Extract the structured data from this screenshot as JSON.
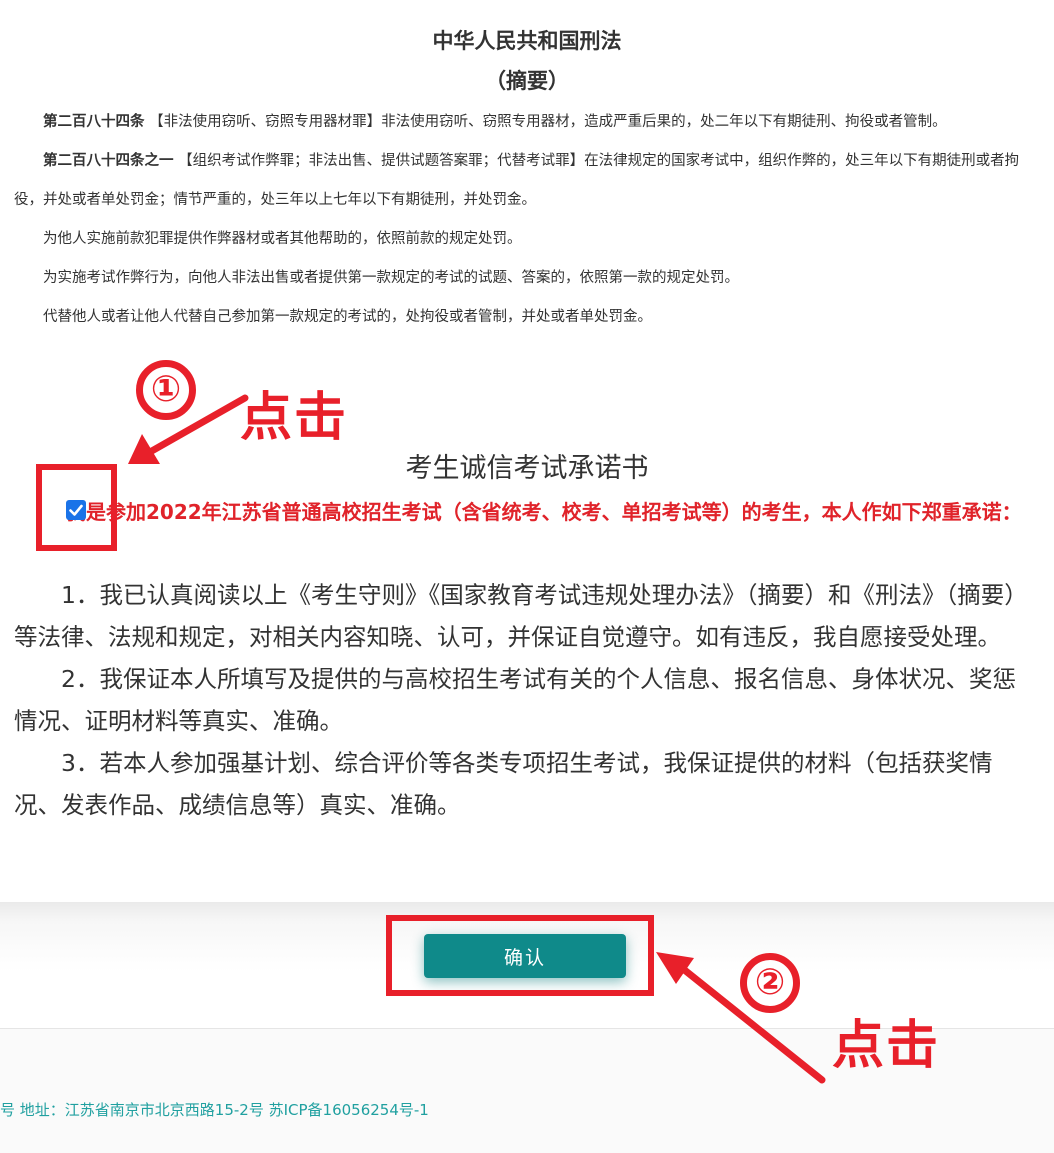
{
  "law": {
    "title": "中华人民共和国刑法",
    "subtitle": "（摘要）",
    "articles": [
      {
        "label": "第二百八十四条",
        "text": "【非法使用窃听、窃照专用器材罪】非法使用窃听、窃照专用器材，造成严重后果的，处二年以下有期徒刑、拘役或者管制。"
      },
      {
        "label": "第二百八十四条之一",
        "text": "【组织考试作弊罪；非法出售、提供试题答案罪；代替考试罪】在法律规定的国家考试中，组织作弊的，处三年以下有期徒刑或者拘役，并处或者单处罚金；情节严重的，处三年以上七年以下有期徒刑，并处罚金。"
      }
    ],
    "paragraphs": [
      "为他人实施前款犯罪提供作弊器材或者其他帮助的，依照前款的规定处罚。",
      "为实施考试作弊行为，向他人非法出售或者提供第一款规定的考试的试题、答案的，依照第一款的规定处罚。",
      "代替他人或者让他人代替自己参加第一款规定的考试的，处拘役或者管制，并处或者单处罚金。"
    ]
  },
  "pledge": {
    "title": "考生诚信考试承诺书",
    "agree_text": "我是参加2022年江苏省普通高校招生考试（含省统考、校考、单招考试等）的考生，本人作如下郑重承诺：",
    "agree_checked": true,
    "items": [
      "1．我已认真阅读以上《考生守则》《国家教育考试违规处理办法》（摘要）和《刑法》（摘要）等法律、法规和规定，对相关内容知晓、认可，并保证自觉遵守。如有违反，我自愿接受处理。",
      "2．我保证本人所填写及提供的与高校招生考试有关的个人信息、报名信息、身体状况、奖惩情况、证明材料等真实、准确。",
      "3．若本人参加强基计划、综合评价等各类专项招生考试，我保证提供的材料（包括获奖情况、发表作品、成绩信息等）真实、准确。"
    ]
  },
  "actions": {
    "confirm_label": "确认"
  },
  "footer": {
    "text": "号 地址：江苏省南京市北京西路15-2号 苏ICP备16056254号-1"
  },
  "annotations": {
    "step1_number": "①",
    "step1_label": "点击",
    "step2_number": "②",
    "step2_label": "点击"
  },
  "colors": {
    "accent_red": "#e8202a",
    "agree_text": "#e0232a",
    "confirm_button": "#0f8a8a",
    "checkbox": "#1a73e8",
    "footer_text": "#20a0a0"
  },
  "icons": {
    "checkbox": "checkmark-icon",
    "arrow": "arrow-icon"
  }
}
